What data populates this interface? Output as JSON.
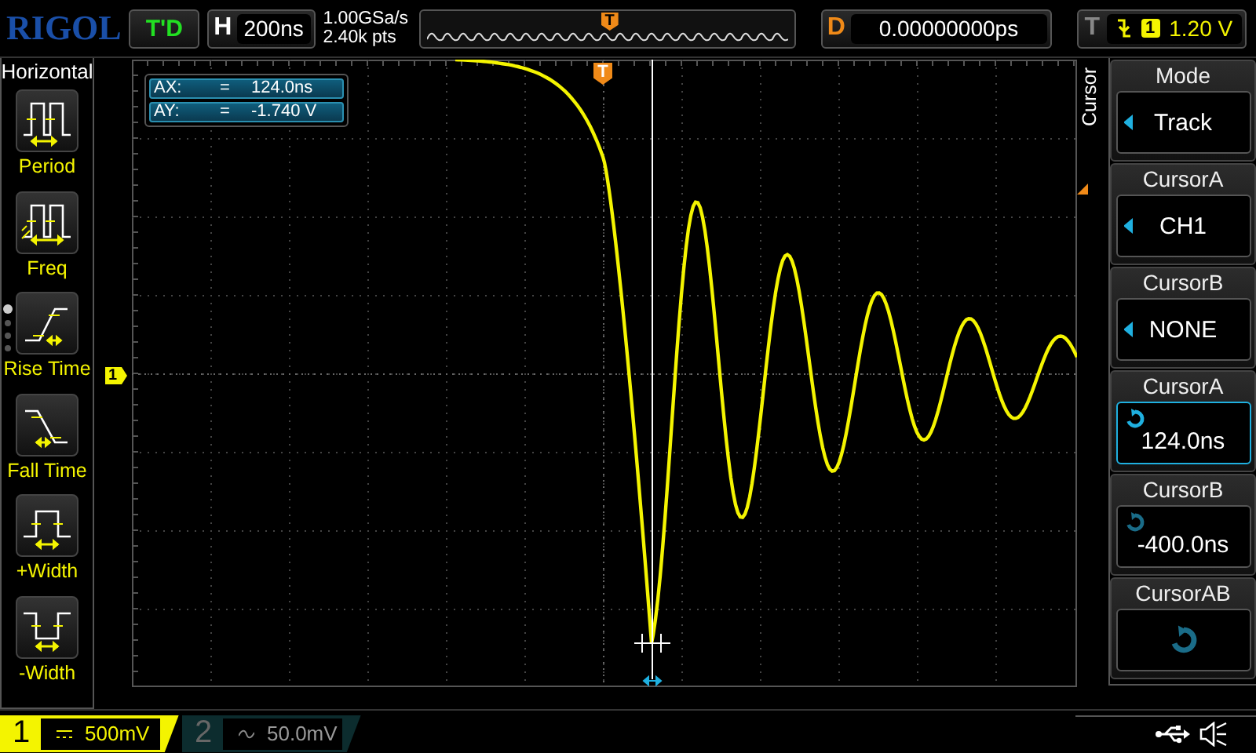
{
  "top_bar": {
    "logo": "RIGOL",
    "run_status": "T'D",
    "horizontal": {
      "label": "H",
      "value": "200ns"
    },
    "sample_rate": "1.00GSa/s",
    "memory_depth": "2.40k pts",
    "timeline_marker": "T",
    "delay": {
      "label": "D",
      "value": "0.00000000ps"
    },
    "trigger": {
      "label": "T",
      "channel": "1",
      "level": "1.20 V"
    }
  },
  "left_menu": {
    "title": "Horizontal",
    "items": [
      {
        "label": "Period",
        "kind": "period"
      },
      {
        "label": "Freq",
        "kind": "freq"
      },
      {
        "label": "Rise Time",
        "kind": "rise"
      },
      {
        "label": "Fall Time",
        "kind": "fall"
      },
      {
        "label": "+Width",
        "kind": "pwidth"
      },
      {
        "label": "-Width",
        "kind": "nwidth"
      }
    ],
    "pages": [
      {
        "selected": true
      },
      {
        "selected": false
      },
      {
        "selected": false
      },
      {
        "selected": false
      }
    ]
  },
  "display": {
    "trigger_marker": "T",
    "channel_marker": "1",
    "cursor_readout": [
      {
        "label": "AX:",
        "sign": "=",
        "value": "124.0ns"
      },
      {
        "label": "AY:",
        "sign": "=",
        "value": "-1.740 V"
      }
    ]
  },
  "right_menu": {
    "title": "Cursor",
    "items": [
      {
        "title": "Mode",
        "value": "Track",
        "kind": "select"
      },
      {
        "title": "CursorA",
        "value": "CH1",
        "kind": "select"
      },
      {
        "title": "CursorB",
        "value": "NONE",
        "kind": "select"
      },
      {
        "title": "CursorA",
        "value": "124.0ns",
        "kind": "knob",
        "selected": true
      },
      {
        "title": "CursorB",
        "value": "-400.0ns",
        "kind": "knob",
        "selected": false
      },
      {
        "title": "CursorAB",
        "kind": "knob",
        "selected": false
      }
    ]
  },
  "channels": [
    {
      "number": "1",
      "scale": "500mV",
      "kind": "dc",
      "on": true
    },
    {
      "number": "2",
      "scale": "50.0mV",
      "kind": "ac",
      "on": false
    }
  ]
}
